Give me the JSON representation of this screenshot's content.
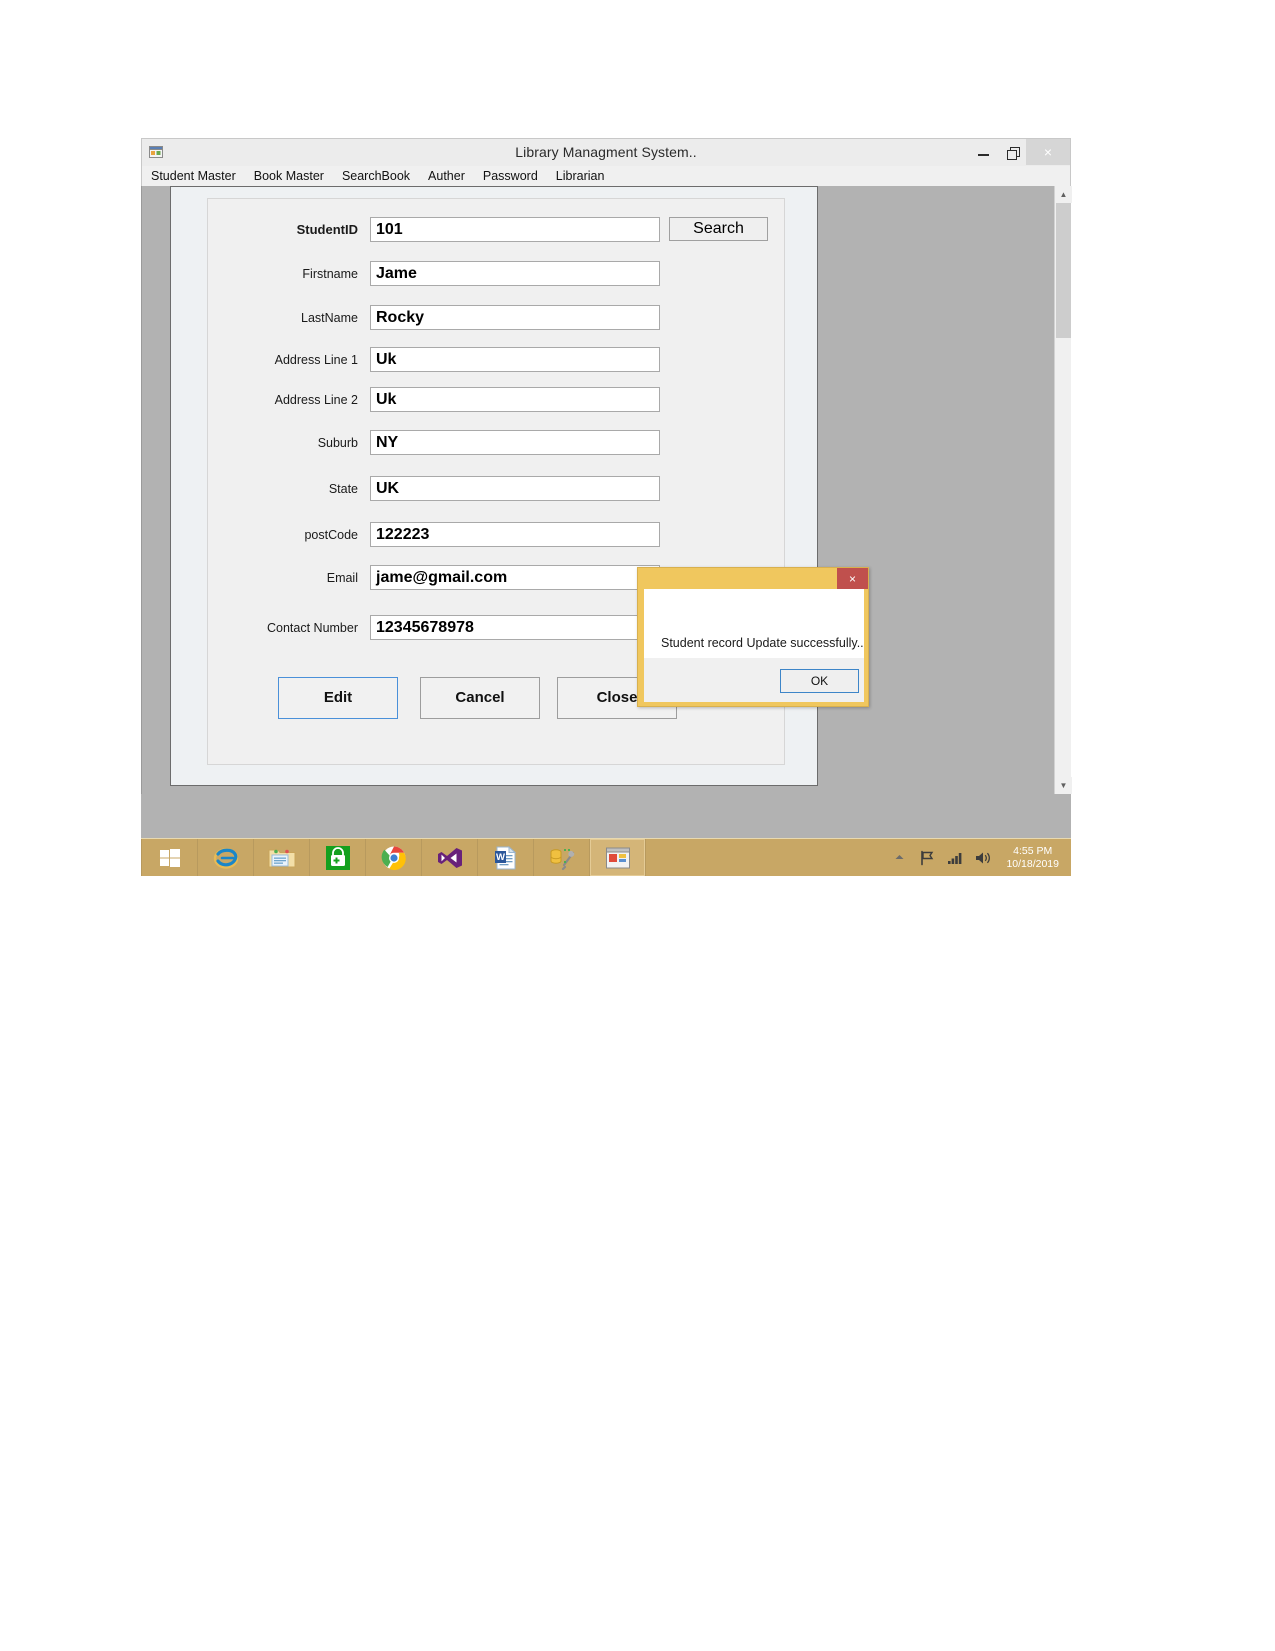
{
  "window": {
    "title": "Library Managment System..",
    "icon": "app-form-icon",
    "minimize_label": "–",
    "restore_label": "❐",
    "close_label": "×"
  },
  "menubar": {
    "items": [
      {
        "label": "Student Master"
      },
      {
        "label": "Book Master"
      },
      {
        "label": "SearchBook"
      },
      {
        "label": "Auther"
      },
      {
        "label": "Password"
      },
      {
        "label": "Librarian"
      }
    ]
  },
  "form": {
    "fields": [
      {
        "label": "StudentID",
        "value": "101",
        "placeholder": ""
      },
      {
        "label": "Firstname",
        "value": "Jame",
        "placeholder": ""
      },
      {
        "label": "LastName",
        "value": "Rocky",
        "placeholder": ""
      },
      {
        "label": "Address Line 1",
        "value": "Uk",
        "placeholder": ""
      },
      {
        "label": "Address Line 2",
        "value": "Uk",
        "placeholder": ""
      },
      {
        "label": "Suburb",
        "value": "NY",
        "placeholder": ""
      },
      {
        "label": "State",
        "value": "UK",
        "placeholder": ""
      },
      {
        "label": "postCode",
        "value": "122223",
        "placeholder": ""
      },
      {
        "label": "Email",
        "value": "jame@gmail.com",
        "placeholder": ""
      },
      {
        "label": "Contact Number",
        "value": "12345678978",
        "placeholder": ""
      }
    ],
    "search_label": "Search",
    "buttons": {
      "edit": "Edit",
      "cancel": "Cancel",
      "close": "Close"
    }
  },
  "dialog": {
    "title": "",
    "message": "Student record Update successfully..",
    "ok_label": "OK",
    "close_label": "×",
    "accent_color": "#f0c75e",
    "close_color": "#c0504d"
  },
  "scrollbar": {
    "up_arrow": "▲",
    "down_arrow": "▼"
  },
  "taskbar": {
    "items": [
      {
        "name": "start-button",
        "label": "Start"
      },
      {
        "name": "internet-explorer",
        "label": "Internet Explorer"
      },
      {
        "name": "file-explorer",
        "label": "File Explorer"
      },
      {
        "name": "windows-store",
        "label": "Store"
      },
      {
        "name": "google-chrome",
        "label": "Google Chrome"
      },
      {
        "name": "visual-studio",
        "label": "Visual Studio"
      },
      {
        "name": "microsoft-word",
        "label": "Microsoft Word"
      },
      {
        "name": "sql-server-tools",
        "label": "SQL Server Tools"
      },
      {
        "name": "library-app",
        "label": "Library Managment System"
      }
    ],
    "tray": {
      "show_hidden": "▲",
      "flag": "flag-icon",
      "network": "network-icon",
      "volume": "volume-icon"
    },
    "clock": {
      "time": "4:55 PM",
      "date": "10/18/2019"
    }
  }
}
